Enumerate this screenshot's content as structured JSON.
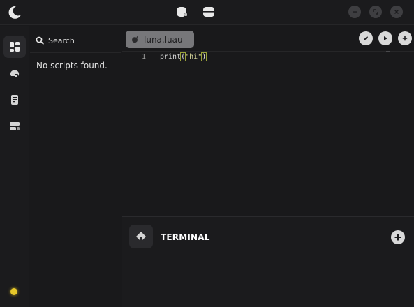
{
  "titlebar": {
    "logo_icon": "moon-icon",
    "center_icons": [
      "cube-icon",
      "window-icon"
    ],
    "window_buttons": [
      "minimize-icon",
      "maximize-icon",
      "close-icon"
    ]
  },
  "rail": {
    "items": [
      "dashboard-icon",
      "cloud-icon",
      "document-icon",
      "storage-icon"
    ],
    "active_index": 0,
    "status_color": "#e6c72a"
  },
  "scripts": {
    "search_label": "Search",
    "empty_text": "No scripts found."
  },
  "editor": {
    "tab_label": "luna.luau",
    "actions": [
      "edit-icon",
      "play-icon",
      "add-icon"
    ],
    "lines": [
      {
        "number": "1",
        "pre": "print",
        "open": "(",
        "string": "\"hi\"",
        "close": ")"
      }
    ]
  },
  "terminal": {
    "title": "TERMINAL",
    "add_icon": "add-circle-icon"
  },
  "colors": {
    "background": "#19191b",
    "tab": "#77777a",
    "accent_status": "#e6c72a"
  }
}
